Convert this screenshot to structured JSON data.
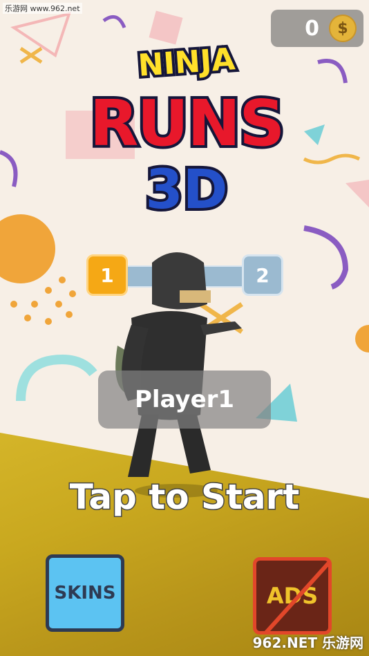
{
  "watermark_top": "乐游网 www.962.net",
  "coins": {
    "count": "0",
    "symbol": "$"
  },
  "logo": {
    "line1": "NINJA",
    "line2": "RUNS",
    "line3": "3D"
  },
  "level": {
    "current": "1",
    "next": "2",
    "progress": 0
  },
  "player": {
    "name": "Player1"
  },
  "prompt": "Tap to Start",
  "buttons": {
    "skins": "SKINS",
    "ads": "ADS"
  },
  "watermark_bottom": "962.NET 乐游网",
  "colors": {
    "logo_yellow": "#ffe02a",
    "logo_red": "#e8182b",
    "logo_blue": "#2450c9",
    "skins_bg": "#5cc3f2",
    "ads_bg": "#6a2517",
    "level_current": "#f5a815",
    "level_next": "#9bbad0"
  }
}
